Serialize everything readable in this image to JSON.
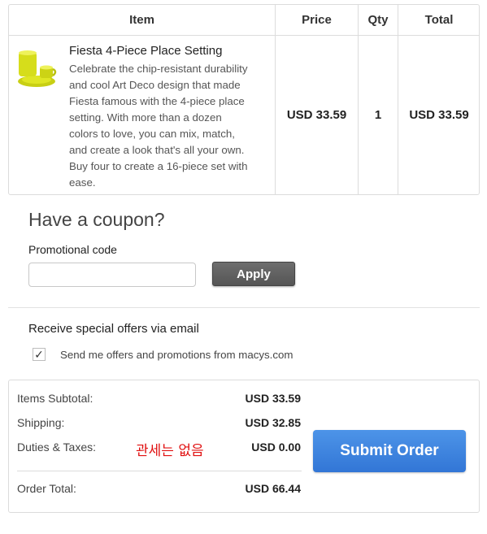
{
  "table": {
    "headers": {
      "item": "Item",
      "price": "Price",
      "qty": "Qty",
      "total": "Total"
    },
    "rows": [
      {
        "name": "Fiesta 4-Piece Place Setting",
        "description": "Celebrate the chip-resistant durability and cool Art Deco design that made Fiesta famous with the 4-piece place setting. With more than a dozen colors to love, you can mix, match, and create a look that's all your own. Buy four to create a 16-piece set with ease.",
        "price": "USD 33.59",
        "qty": "1",
        "total": "USD 33.59",
        "image_icon": "yellow-dinnerware-set",
        "image_color": "#d8e01a"
      }
    ]
  },
  "coupon": {
    "title": "Have a coupon?",
    "label": "Promotional code",
    "value": "",
    "apply_label": "Apply"
  },
  "offers": {
    "title": "Receive special offers via email",
    "checkbox_label": "Send me offers and promotions from macys.com",
    "checked": true
  },
  "summary": {
    "subtotal_label": "Items Subtotal:",
    "subtotal_value": "USD 33.59",
    "shipping_label": "Shipping:",
    "shipping_value": "USD 32.85",
    "duties_label": "Duties & Taxes:",
    "duties_note": "관세는 없음",
    "duties_value": "USD 0.00",
    "total_label": "Order Total:",
    "total_value": "USD 66.44",
    "submit_label": "Submit Order"
  },
  "colors": {
    "submit_button": "#3a7fdc",
    "apply_button": "#606060",
    "note_red": "#e01010"
  }
}
